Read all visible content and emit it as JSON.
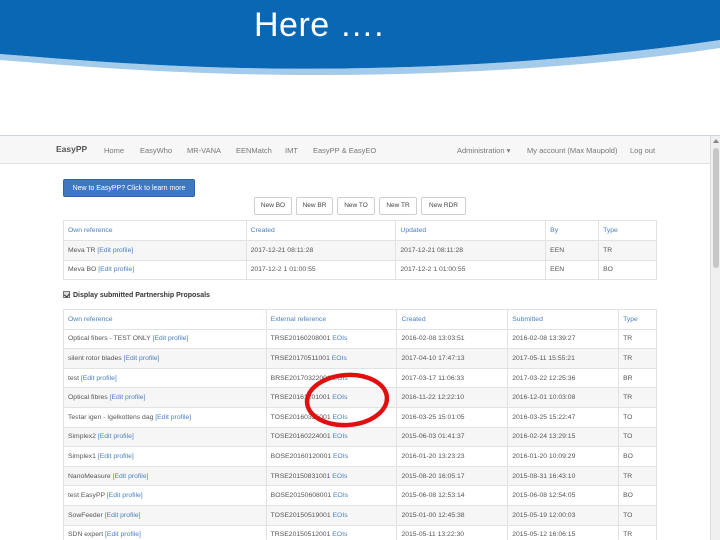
{
  "slide": {
    "title": "Here …."
  },
  "navbar": {
    "brand": "EasyPP",
    "items": [
      "Home",
      "EasyWho",
      "MR-VANA",
      "EENMatch",
      "IMT",
      "EasyPP & EasyEO"
    ],
    "admin": "Administration ▾",
    "account": "My account (Max Maupold)",
    "logout": "Log out"
  },
  "learn_more_label": "New to EasyPP? Click to learn more",
  "new_buttons": [
    "New BO",
    "New BR",
    "New TO",
    "New TR",
    "New RDR"
  ],
  "bo_table": {
    "headers": [
      "Own reference",
      "Created",
      "Updated",
      "By",
      "Type"
    ],
    "rows": [
      {
        "ref": "Meva TR",
        "edit": "[Edit profile]",
        "created": "2017-12-21 08:11:28",
        "updated": "2017-12-21 08:11:28",
        "by": "EEN",
        "type": "TR"
      },
      {
        "ref": "Meva BO",
        "edit": "[Edit profile]",
        "created": "2017-12-2 1 01:00:55",
        "updated": "2017-12-2 1 01:00:55",
        "by": "EEN",
        "type": "BO"
      }
    ]
  },
  "display_label": "Display submitted Partnership Proposals",
  "pp_table": {
    "headers": [
      "Own reference",
      "External reference",
      "Created",
      "Submitted",
      "Type"
    ],
    "eois": "EOIs",
    "rows": [
      {
        "ref": "Optical fibers - TEST ONLY",
        "edit": "[Edit profile]",
        "ext": "TRSE20160208001",
        "created": "2016-02-08 13:03:51",
        "submitted": "2016-02-08 13:39:27",
        "type": "TR"
      },
      {
        "ref": "silent rotor blades",
        "edit": "[Edit profile]",
        "ext": "TRSE20170511001",
        "created": "2017-04-10 17:47:13",
        "submitted": "2017-05-11 15:55:21",
        "type": "TR"
      },
      {
        "ref": "test",
        "edit": "[Edit profile]",
        "ext": "BRSE20170322001",
        "created": "2017-03-17 11:06:33",
        "submitted": "2017-03-22 12:25:36",
        "type": "BR"
      },
      {
        "ref": "Optical fibres",
        "edit": "[Edit profile]",
        "ext": "TRSE20161201001",
        "created": "2016-11-22 12:22:10",
        "submitted": "2016-12-01 10:03:08",
        "type": "TR"
      },
      {
        "ref": "Testar igen - Igelkottens dag",
        "edit": "[Edit profile]",
        "ext": "TOSE20160325001",
        "created": "2016-03-25 15:01:05",
        "submitted": "2016-03-25 15:22:47",
        "type": "TO"
      },
      {
        "ref": "Simplex2",
        "edit": "[Edit profile]",
        "ext": "TOSE20160224001",
        "created": "2015-06-03 01:41:37",
        "submitted": "2016-02-24 13:29:15",
        "type": "TO"
      },
      {
        "ref": "Simplex1",
        "edit": "[Edit profile]",
        "ext": "BOSE20160120001",
        "created": "2016-01-20 13:23:23",
        "submitted": "2016-01-20 10:09:29",
        "type": "BO"
      },
      {
        "ref": "NanoMeasure",
        "edit": "[Edit profile]",
        "ext": "TRSE20150831001",
        "created": "2015-08-20 16:05:17",
        "submitted": "2015-08-31 16:43:10",
        "type": "TR"
      },
      {
        "ref": "test EasyPP",
        "edit": "[Edit profile]",
        "ext": "BOSE20150608001",
        "created": "2015-06-08 12:53:14",
        "submitted": "2015-06-08 12:54:05",
        "type": "BO"
      },
      {
        "ref": "SowFeeder",
        "edit": "[Edit profile]",
        "ext": "TOSE20150519001",
        "created": "2015-01-00 12:45:38",
        "submitted": "2015-05-19 12:00:03",
        "type": "TO"
      },
      {
        "ref": "SDN expert",
        "edit": "[Edit profile]",
        "ext": "TRSE20150512001",
        "created": "2015-05-11 13:22:30",
        "submitted": "2015-05-12 16:06:15",
        "type": "TR"
      }
    ]
  },
  "colors": {
    "slide_header": "#0a67b3",
    "highlight": "#e01010",
    "link": "#4a7fbf",
    "primary_button": "#3f78c2"
  }
}
